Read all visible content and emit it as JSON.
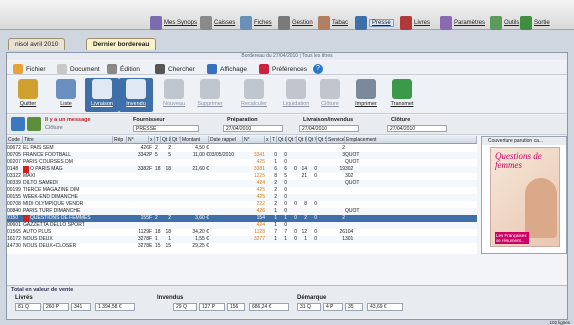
{
  "menubar": {
    "items": [
      {
        "label": "Mes Synops",
        "icon": "grid-icon"
      },
      {
        "label": "Caisses",
        "icon": "register-icon"
      },
      {
        "label": "Fiches",
        "icon": "cards-icon"
      },
      {
        "label": "Gestion",
        "icon": "gear-icon"
      },
      {
        "label": "Tabac",
        "icon": "tabac-icon"
      },
      {
        "label": "Presse",
        "icon": "newspaper-icon",
        "active": true
      },
      {
        "label": "Livres",
        "icon": "book-icon"
      },
      {
        "label": "Paramètres",
        "icon": "settings-icon"
      },
      {
        "label": "Outils",
        "icon": "tools-icon"
      },
      {
        "label": "Sortie",
        "icon": "exit-icon"
      }
    ]
  },
  "tabs": [
    {
      "label": "nisol avril 2010"
    },
    {
      "label": "Dernier bordereau"
    }
  ],
  "window": {
    "title": "Bordereau du 27/04/2010 | Tous les titres",
    "menus": [
      {
        "label": "Fichier",
        "icon": "file-icon"
      },
      {
        "label": "Document",
        "icon": "document-icon"
      },
      {
        "label": "Édition",
        "icon": "pen-icon"
      },
      {
        "label": "Chercher",
        "icon": "binoculars-icon"
      },
      {
        "label": "Affichage",
        "icon": "monitor-icon"
      },
      {
        "label": "Préférences",
        "icon": "heart-icon"
      },
      {
        "label": "?",
        "icon": "help-icon"
      }
    ],
    "toolbar": [
      {
        "label": "Quitter",
        "icon": "exit-door-icon",
        "state": "normal"
      },
      {
        "label": "Liste",
        "icon": "list-icon",
        "state": "normal"
      },
      {
        "label": "Livraison",
        "icon": "delivery-icon",
        "state": "selected"
      },
      {
        "label": "Invendu",
        "icon": "unsold-icon",
        "state": "selected"
      },
      {
        "label": "Nouveau",
        "icon": "plus-icon",
        "state": "disabled"
      },
      {
        "label": "Supprimer",
        "icon": "trash-icon",
        "state": "disabled"
      },
      {
        "label": "Recalculer",
        "icon": "calculator-icon",
        "state": "disabled"
      },
      {
        "label": "Liquidation",
        "icon": "liquidation-icon",
        "state": "disabled"
      },
      {
        "label": "Clôture",
        "icon": "closure-icon",
        "state": "disabled"
      },
      {
        "label": "Imprimer",
        "icon": "printer-icon",
        "state": "normal"
      },
      {
        "label": "Transmet",
        "icon": "globe-icon",
        "state": "normal"
      }
    ],
    "filter": {
      "message_label": "Il y a un message",
      "message_sub": "Clôture",
      "fournisseur_label": "Fournisseur",
      "fournisseur_value": "PRESSE",
      "preparation_label": "Préparation",
      "preparation_value": "27/04/2010",
      "livraison_label": "Livraison/invendus",
      "livraison_value": "27/04/2010",
      "cloture_label": "Clôture",
      "cloture_value": "27/04/2010"
    }
  },
  "grid": {
    "headers": [
      "Code",
      "Titre",
      "Rép",
      "N°",
      "x",
      "T",
      "Qt L",
      "Qt T",
      "Montant",
      "Date rappel",
      "N°",
      "x",
      "T",
      "Qt L",
      "Qt T",
      "Qt I",
      "Qt V",
      "Qt S",
      "Service",
      "Emplacement"
    ],
    "rows": [
      {
        "code": "00672",
        "titre": "EL PAIS SEM",
        "num": "426",
        "x": "F",
        "t": "2",
        "ql": "2",
        "montant": "4,50 €",
        "num2": "",
        "e": "2"
      },
      {
        "code": "00705",
        "titre": "FRANCE FOOTBALL",
        "num": "3342",
        "x": "P",
        "t": "5",
        "ql": "5",
        "montant": "11,00 €",
        "date": "03/05/2010",
        "num2": "3341",
        "d1": "0",
        "d2": "0",
        "e": "3",
        "emp": "QUOT"
      },
      {
        "code": "00207",
        "titre": "PARIS COURSES DM",
        "num2": "425",
        "d1": "1",
        "d2": "0",
        "emp": "QUOT"
      },
      {
        "code": "0148",
        "titre": "O PARIS MAG",
        "flag": true,
        "num": "3382",
        "x": "F",
        "t": "18",
        "ql": "18",
        "montant": "21,60 €",
        "num2": "3381",
        "d1": "6",
        "d2": "6",
        "d3": "0",
        "d4": "14",
        "d5": "0",
        "e": "19",
        "emp": "302"
      },
      {
        "code": "03322",
        "titre": "MAXI",
        "num2": "1225",
        "d1": "8",
        "d2": "5",
        "d3": "",
        "d4": "21",
        "d5": "0",
        "emp": "302"
      },
      {
        "code": "00339",
        "titre": "DILTO SAMEDI",
        "num2": "424",
        "d1": "2",
        "d2": "0",
        "emp": "QUOT"
      },
      {
        "code": "00199",
        "titre": "TIERCE MAGAZINE DIM",
        "num2": "425",
        "d1": "2",
        "d2": "0"
      },
      {
        "code": "00155",
        "titre": "WEEK-END DIMANCHE",
        "num2": "425",
        "d1": "2",
        "d2": "0"
      },
      {
        "code": "00708",
        "titre": "MIDI OLYMPIQUE VENDR",
        "num2": "222",
        "d1": "2",
        "d2": "0",
        "d3": "0",
        "d4": "8",
        "d5": "0"
      },
      {
        "code": "00840",
        "titre": "PARIS TURF DIMANCHE",
        "num2": "426",
        "d1": "1",
        "d2": "0",
        "emp": "QUOT"
      },
      {
        "code": "0150",
        "titre": "QUESTIONS DE FEMMES",
        "flag": true,
        "selected": true,
        "num": "155",
        "x": "F",
        "t": "2",
        "ql": "2",
        "montant": "3,60 €",
        "num2": "154",
        "d1": "1",
        "d2": "1",
        "d3": "0",
        "d4": "2",
        "d5": "0",
        "e": "2"
      },
      {
        "code": "00601",
        "titre": "GAZZETTA DELLO SPORT",
        "num2": "424",
        "d1": "1",
        "d2": "0"
      },
      {
        "code": "01565",
        "titre": "AUTO PLUS",
        "num": "1129",
        "x": "F",
        "t": "18",
        "ql": "18",
        "montant": "34,20 €",
        "num2": "1128",
        "d1": "7",
        "d2": "7",
        "d3": "0",
        "d4": "12",
        "d5": "0",
        "e": "26",
        "emp": "104"
      },
      {
        "code": "16172",
        "titre": "NOUS DEUX",
        "num": "3278",
        "x": "F",
        "t": "1",
        "ql": "1",
        "montant": "1,55 €",
        "num2": "3277",
        "d1": "1",
        "d2": "1",
        "d3": "0",
        "d4": "1",
        "d5": "0",
        "e": "1",
        "emp": "301"
      },
      {
        "code": "14730",
        "titre": "NOUS DEUX+CLOSER",
        "num": "3278",
        "x": "E",
        "t": "15",
        "ql": "15",
        "montant": "29,25 €",
        "num2": "",
        "check": true
      }
    ]
  },
  "promo": {
    "title": "Couverture parution ca...",
    "cover_title": "Questions de femmes",
    "cover_caption": "Les Françaises se résument..."
  },
  "totals": {
    "section_label": "Total en valeur de vente",
    "livres_label": "Livrés",
    "livres_q": "81 Q",
    "livres_a": "260 P",
    "livres_b": "341",
    "livres_total": "1 394,58 €",
    "invendus_label": "Invendus",
    "inv_q": "29 Q",
    "inv_a": "127 P",
    "inv_b": "156",
    "inv_total": "686,24 €",
    "demarque_label": "Démarque",
    "dem_q": "31 Q",
    "dem_a": "4 P",
    "dem_b": "35",
    "dem_total": "43,69 €"
  },
  "status": {
    "count": "102 lignes"
  },
  "colors": {
    "accent": "#3f6fa8",
    "orange": "#d87a14",
    "selected_row": "#3f6fa8"
  }
}
